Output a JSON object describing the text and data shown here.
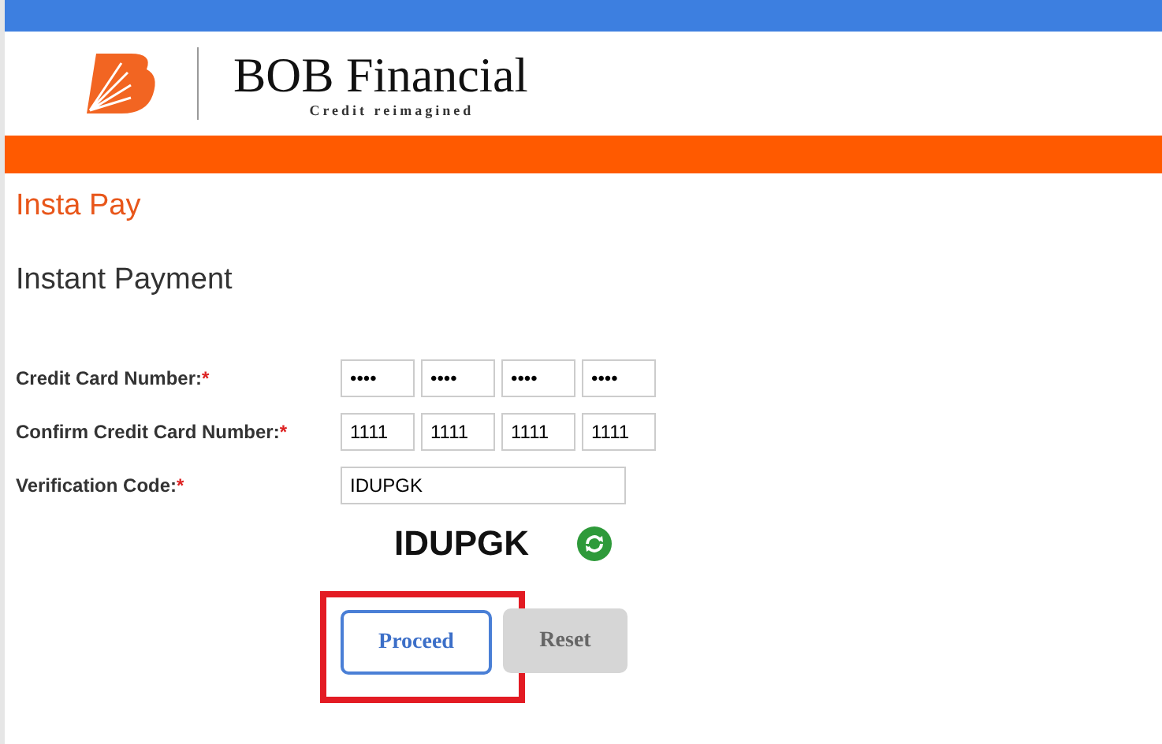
{
  "header": {
    "brand": "BOB Financial",
    "tagline": "Credit reimagined"
  },
  "section_title": "Insta Pay",
  "form": {
    "title": "Instant Payment",
    "rows": [
      {
        "kind": "card",
        "label": "Credit Card Number:",
        "required_mark": "*",
        "values": [
          "••••",
          "••••",
          "••••",
          "••••"
        ]
      },
      {
        "kind": "card",
        "label": "Confirm Credit Card Number:",
        "required_mark": "*",
        "values": [
          "1111",
          "1111",
          "1111",
          "1111"
        ]
      },
      {
        "kind": "text",
        "label": "Verification Code:",
        "required_mark": "*",
        "value": "IDUPGK"
      }
    ],
    "captcha": "IDUPGK",
    "buttons": [
      {
        "label": "Proceed",
        "kind": "primary",
        "highlighted": true
      },
      {
        "label": "Reset",
        "kind": "secondary",
        "highlighted": false
      }
    ]
  }
}
